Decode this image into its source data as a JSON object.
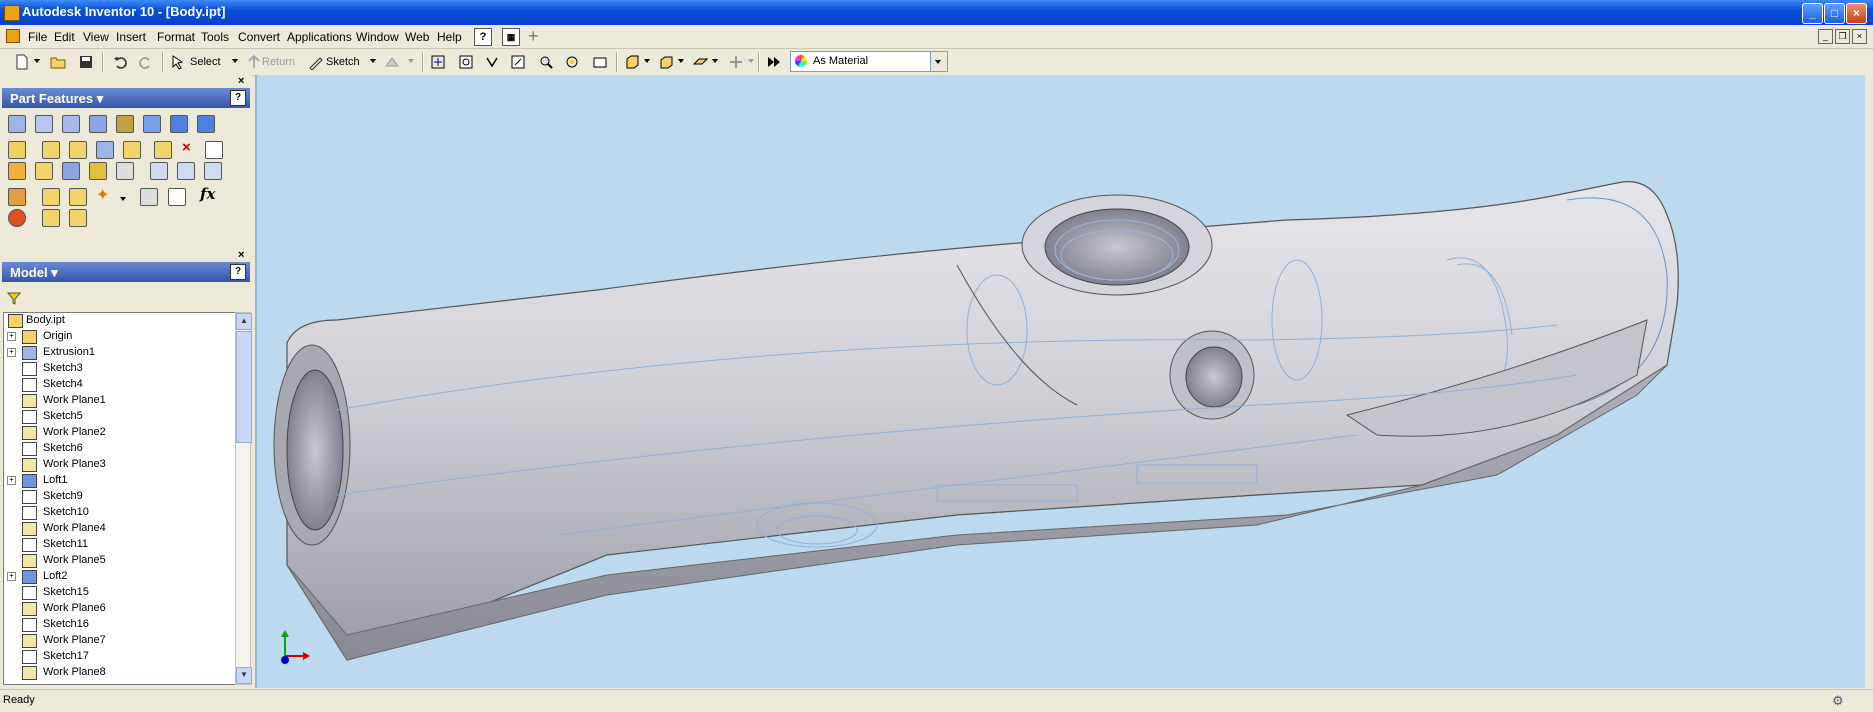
{
  "window": {
    "title": "Autodesk Inventor 10 - [Body.ipt]"
  },
  "menu": {
    "items": [
      "File",
      "Edit",
      "View",
      "Insert",
      "Format",
      "Tools",
      "Convert",
      "Applications",
      "Window",
      "Web",
      "Help"
    ]
  },
  "toolbar": {
    "select_label": "Select",
    "return_label": "Return",
    "sketch_label": "Sketch",
    "material_value": "As Material"
  },
  "panels": {
    "features": {
      "title": "Part Features ▾"
    },
    "model": {
      "title": "Model ▾"
    }
  },
  "tree": {
    "root": "Body.ipt",
    "items": [
      {
        "label": "Origin",
        "icon": "folder-icon",
        "expand": "+"
      },
      {
        "label": "Extrusion1",
        "icon": "extrusion-icon",
        "expand": "+"
      },
      {
        "label": "Sketch3",
        "icon": "sketch-icon",
        "expand": ""
      },
      {
        "label": "Sketch4",
        "icon": "sketch-icon",
        "expand": ""
      },
      {
        "label": "Work Plane1",
        "icon": "work-plane-icon",
        "expand": ""
      },
      {
        "label": "Sketch5",
        "icon": "sketch-icon",
        "expand": ""
      },
      {
        "label": "Work Plane2",
        "icon": "work-plane-icon",
        "expand": ""
      },
      {
        "label": "Sketch6",
        "icon": "sketch-icon",
        "expand": ""
      },
      {
        "label": "Work Plane3",
        "icon": "work-plane-icon",
        "expand": ""
      },
      {
        "label": "Loft1",
        "icon": "loft-icon",
        "expand": "+"
      },
      {
        "label": "Sketch9",
        "icon": "sketch-icon",
        "expand": ""
      },
      {
        "label": "Sketch10",
        "icon": "sketch-icon",
        "expand": ""
      },
      {
        "label": "Work Plane4",
        "icon": "work-plane-icon",
        "expand": ""
      },
      {
        "label": "Sketch11",
        "icon": "sketch-icon",
        "expand": ""
      },
      {
        "label": "Work Plane5",
        "icon": "work-plane-icon",
        "expand": ""
      },
      {
        "label": "Loft2",
        "icon": "loft-icon",
        "expand": "+"
      },
      {
        "label": "Sketch15",
        "icon": "sketch-icon",
        "expand": ""
      },
      {
        "label": "Work Plane6",
        "icon": "work-plane-icon",
        "expand": ""
      },
      {
        "label": "Sketch16",
        "icon": "sketch-icon",
        "expand": ""
      },
      {
        "label": "Work Plane7",
        "icon": "work-plane-icon",
        "expand": ""
      },
      {
        "label": "Sketch17",
        "icon": "sketch-icon",
        "expand": ""
      },
      {
        "label": "Work Plane8",
        "icon": "work-plane-icon",
        "expand": ""
      }
    ]
  },
  "status": {
    "text": "Ready"
  },
  "colors": {
    "viewport_bg": "#bcd9f0",
    "titlebar": "#0a4fd8",
    "panel_header": "#3556a8"
  }
}
